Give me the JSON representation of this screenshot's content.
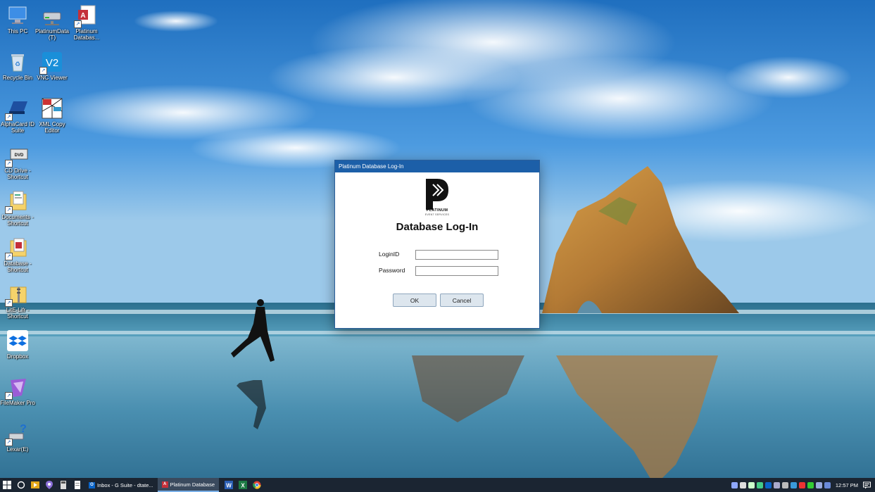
{
  "desktop": {
    "icons": [
      {
        "label": "This PC"
      },
      {
        "label": "PlatinumData (T)"
      },
      {
        "label": "Platinum Databas..."
      },
      {
        "label": "Recycle Bin"
      },
      {
        "label": "VNC Viewer"
      },
      {
        "label": "AlphaCard ID Suite"
      },
      {
        "label": "XML Copy Editor"
      },
      {
        "label": "CD Drive - Shortcut"
      },
      {
        "label": "Documents - Shortcut"
      },
      {
        "label": "Database - Shortcut"
      },
      {
        "label": "LitE-Lifr - Shortcut"
      },
      {
        "label": "Dropbox"
      },
      {
        "label": "FileMaker Pro"
      },
      {
        "label": "Lexar(E)"
      }
    ]
  },
  "dialog": {
    "title": "Platinum Database Log-In",
    "logo": {
      "name": "PLATINUM",
      "tagline": "EVENT SERVICES"
    },
    "heading": "Database Log-In",
    "login_label": "LoginID",
    "login_value": "",
    "password_label": "Password",
    "password_value": "",
    "ok_label": "OK",
    "cancel_label": "Cancel"
  },
  "taskbar": {
    "apps": [
      {
        "label": "Inbox - G Suite - dtate..."
      },
      {
        "label": "Platinum Database"
      }
    ],
    "clock": "12:57 PM"
  },
  "colors": {
    "titlebar": "#1c5fa8",
    "taskbar": "#1b2532",
    "button": "#dde6ee"
  }
}
